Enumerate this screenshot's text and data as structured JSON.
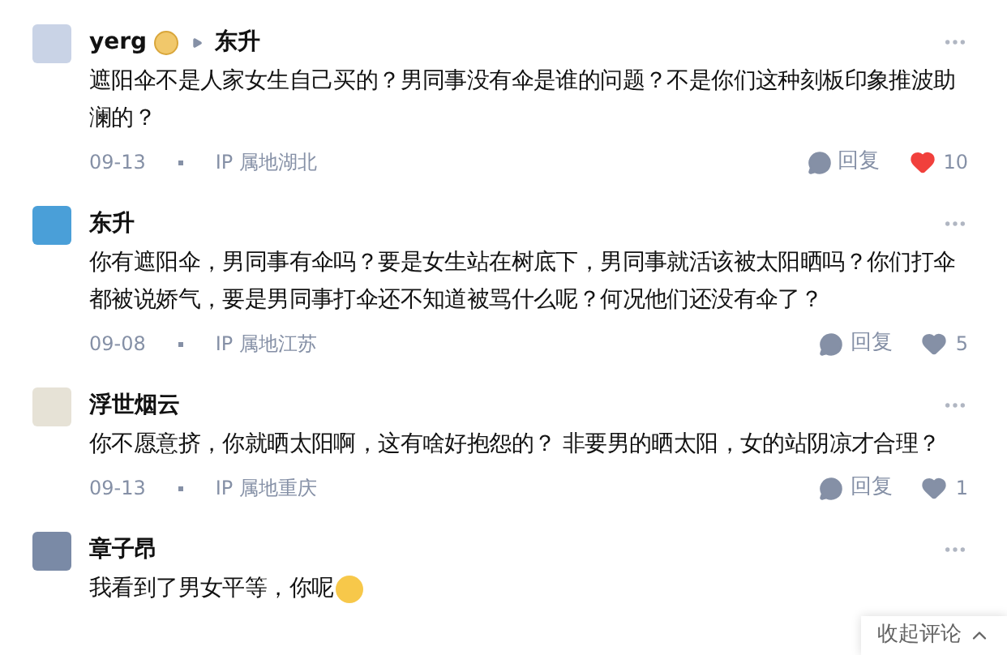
{
  "comments": [
    {
      "author": "yerg",
      "badge": true,
      "reply_to": "东升",
      "text": "遮阳伞不是人家女生自己买的？男同事没有伞是谁的问题？不是你们这种刻板印象推波助澜的？",
      "date": "09-13",
      "location": "IP 属地湖北",
      "reply_label": "回复",
      "likes": "10",
      "liked": true
    },
    {
      "author": "东升",
      "text": "你有遮阳伞，男同事有伞吗？要是女生站在树底下，男同事就活该被太阳晒吗？你们打伞都被说娇气，要是男同事打伞还不知道被骂什么呢？何况他们还没有伞了？",
      "date": "09-08",
      "location": "IP 属地江苏",
      "reply_label": "回复",
      "likes": "5",
      "liked": false
    },
    {
      "author": "浮世烟云",
      "text": "你不愿意挤，你就晒太阳啊，这有啥好抱怨的？  非要男的晒太阳，女的站阴凉才合理？",
      "date": "09-13",
      "location": "IP 属地重庆",
      "reply_label": "回复",
      "likes": "1",
      "liked": false
    },
    {
      "author": "章子昂",
      "text": "我看到了男女平等，你呢",
      "emoji": true
    }
  ],
  "collapse_button": {
    "label": "收起评论"
  }
}
